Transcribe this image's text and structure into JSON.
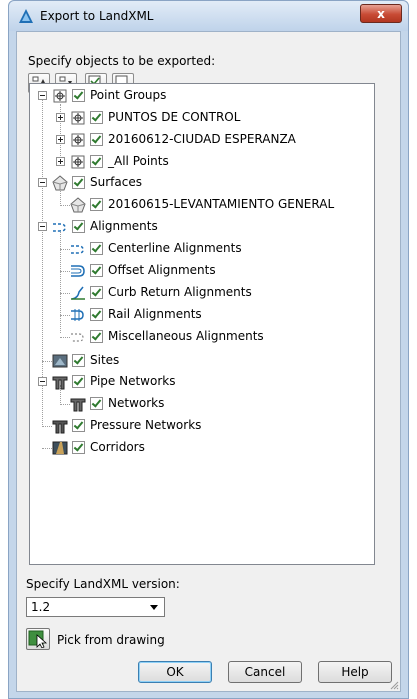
{
  "window": {
    "title": "Export to LandXML",
    "close_glyph": "x"
  },
  "dialog": {
    "prompt": "Specify objects to be exported:",
    "toolbar_icons": [
      "select-all-icon",
      "select-by-filter-icon",
      "check-all-icon",
      "uncheck-all-icon"
    ],
    "version_label": "Specify LandXML version:",
    "version_value": "1.2",
    "pick_label": "Pick from drawing",
    "ok_label": "OK",
    "cancel_label": "Cancel",
    "help_label": "Help"
  },
  "tree": {
    "point_groups": {
      "label": "Point Groups",
      "children": [
        "PUNTOS DE CONTROL",
        "20160612-CIUDAD ESPERANZA",
        "_All Points"
      ]
    },
    "surfaces": {
      "label": "Surfaces",
      "children": [
        "20160615-LEVANTAMIENTO GENERAL"
      ]
    },
    "alignments": {
      "label": "Alignments",
      "children": [
        "Centerline Alignments",
        "Offset Alignments",
        "Curb Return Alignments",
        "Rail Alignments",
        "Miscellaneous Alignments"
      ]
    },
    "sites": {
      "label": "Sites"
    },
    "pipe_networks": {
      "label": "Pipe Networks",
      "children": [
        "Networks"
      ]
    },
    "pressure_networks": {
      "label": "Pressure Networks"
    },
    "corridors": {
      "label": "Corridors"
    }
  },
  "colors": {
    "check": "#2f7a2f",
    "frame": "#c4d6ea",
    "close": "#c84b35"
  }
}
